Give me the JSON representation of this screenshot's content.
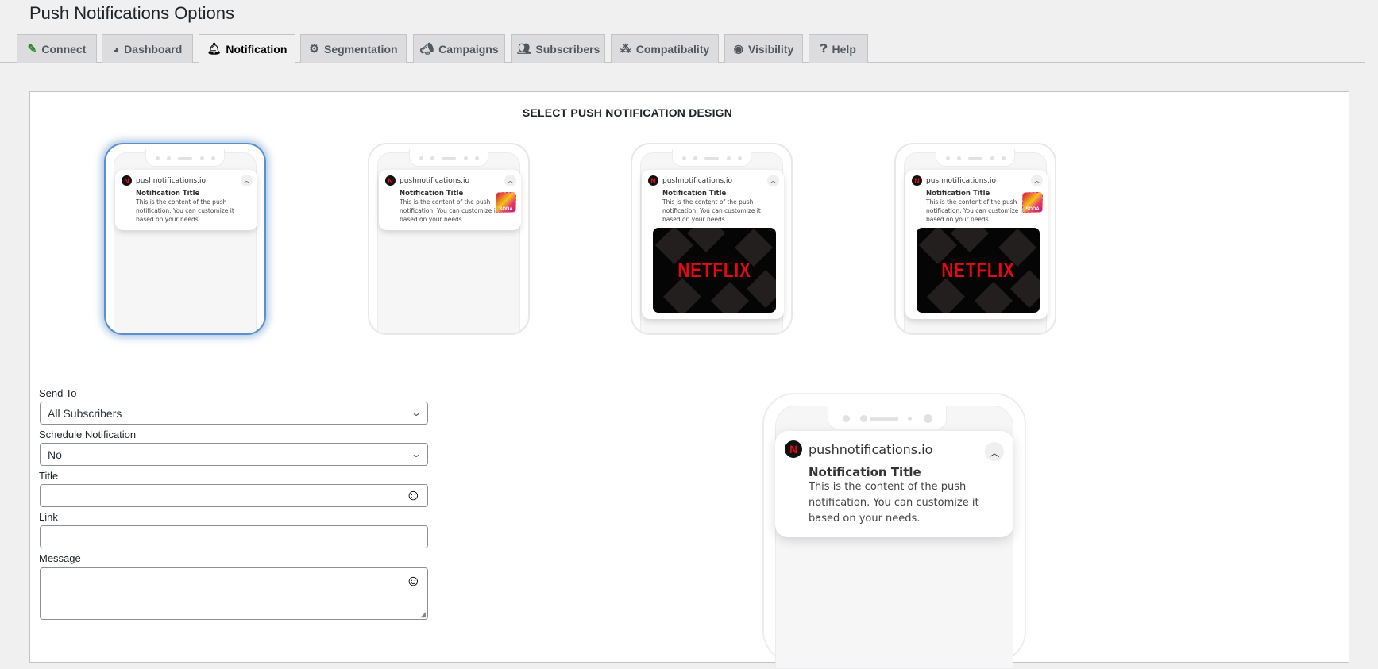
{
  "page_title": "Push Notifications Options",
  "tabs": [
    {
      "label": "Connect",
      "icon": "plug-icon"
    },
    {
      "label": "Dashboard",
      "icon": "dashboard-icon"
    },
    {
      "label": "Notification",
      "icon": "bell-icon"
    },
    {
      "label": "Segmentation",
      "icon": "gear-icon"
    },
    {
      "label": "Campaigns",
      "icon": "megaphone-icon"
    },
    {
      "label": "Subscribers",
      "icon": "users-icon"
    },
    {
      "label": "Compatibality",
      "icon": "circles-icon"
    },
    {
      "label": "Visibility",
      "icon": "eye-icon"
    },
    {
      "label": "Help",
      "icon": "help-icon"
    }
  ],
  "active_tab": "Notification",
  "design": {
    "heading": "SELECT PUSH NOTIFICATION DESIGN",
    "selected_index": 0,
    "site": "pushnotifications.io",
    "ntitle": "Notification Title",
    "nbody": "This is the content of the push notification. You can customize it based on your needs.",
    "logo_letter": "N",
    "image_text": "NETFLIX",
    "candy_text": "SODA"
  },
  "form": {
    "send_to_label": "Send To",
    "send_to_value": "All Subscribers",
    "schedule_label": "Schedule Notification",
    "schedule_value": "No",
    "title_label": "Title",
    "title_value": "",
    "link_label": "Link",
    "link_value": "",
    "message_label": "Message",
    "message_value": ""
  },
  "colors": {
    "accent": "#5a8fc9",
    "netflix_red": "#e50914"
  }
}
